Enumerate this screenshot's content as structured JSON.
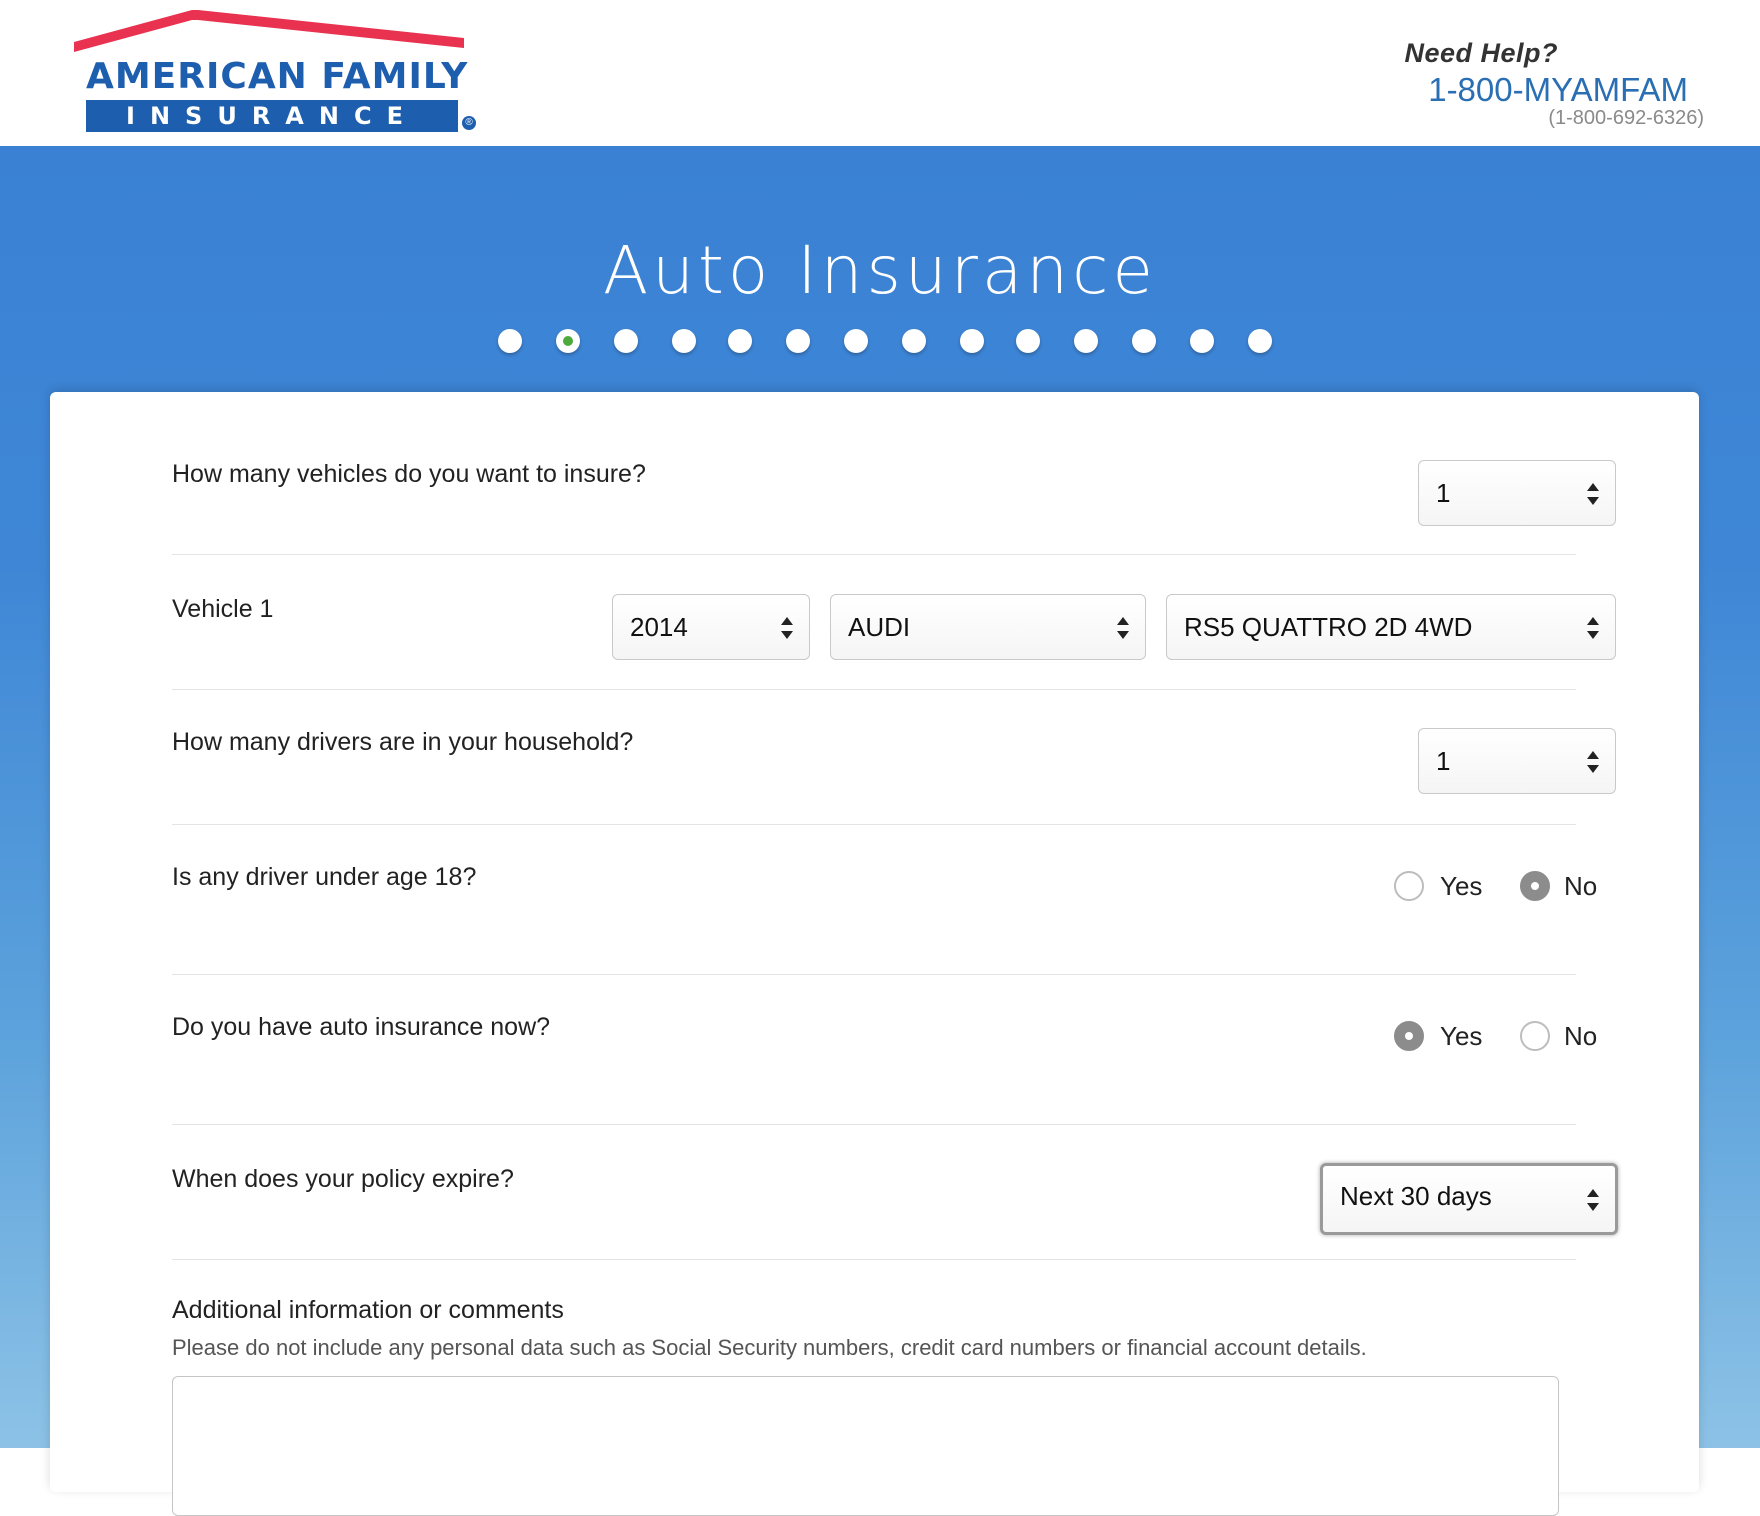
{
  "header": {
    "logo": {
      "line1": "AMERICAN FAMILY",
      "line2": "INSURANCE",
      "registered": "®"
    },
    "help": {
      "label": "Need Help?",
      "phone_vanity": "1-800-MYAMFAM",
      "phone_number": "(1-800-692-6326)"
    }
  },
  "page": {
    "title": "Auto Insurance",
    "progress": {
      "total_steps": 14,
      "current_step": 2
    }
  },
  "form": {
    "vehicles": {
      "question": "How many vehicles do you want to insure?",
      "value": "1"
    },
    "vehicle1": {
      "label": "Vehicle 1",
      "year": "2014",
      "make": "AUDI",
      "model": "RS5 QUATTRO 2D 4WD"
    },
    "drivers": {
      "question": "How many drivers are in your household?",
      "value": "1"
    },
    "under18": {
      "question": "Is any driver under age 18?",
      "yes_label": "Yes",
      "no_label": "No",
      "selected": "No"
    },
    "has_insurance": {
      "question": "Do you have auto insurance now?",
      "yes_label": "Yes",
      "no_label": "No",
      "selected": "Yes"
    },
    "expire": {
      "question": "When does your policy expire?",
      "value": "Next 30 days"
    },
    "comments": {
      "title": "Additional information or comments",
      "note": "Please do not include any personal data such as Social Security numbers, credit card numbers or financial account details.",
      "value": ""
    }
  },
  "colors": {
    "brand_blue": "#1d5eae",
    "roof_red": "#e8324f",
    "hero_blue": "#3a81d4",
    "progress_active": "#4caa3c"
  },
  "icons": {
    "select_arrows": "up-down-arrows-icon"
  }
}
